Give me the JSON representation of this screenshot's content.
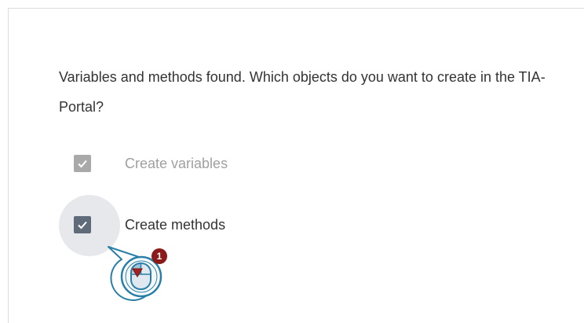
{
  "dialog": {
    "message": "Variables and methods found. Which objects do you want to create in the TIA-Portal?"
  },
  "options": [
    {
      "label": "Create variables",
      "checked": true,
      "enabled": false
    },
    {
      "label": "Create methods",
      "checked": true,
      "enabled": true
    }
  ],
  "annotation": {
    "step_badge": "1",
    "icon": "mouse-click-cursor-icon"
  },
  "colors": {
    "checkbox_disabled": "#a9a9a9",
    "checkbox_enabled": "#5f6b79",
    "badge": "#8b1a1a",
    "cursor_accent": "#2a7fa8"
  }
}
